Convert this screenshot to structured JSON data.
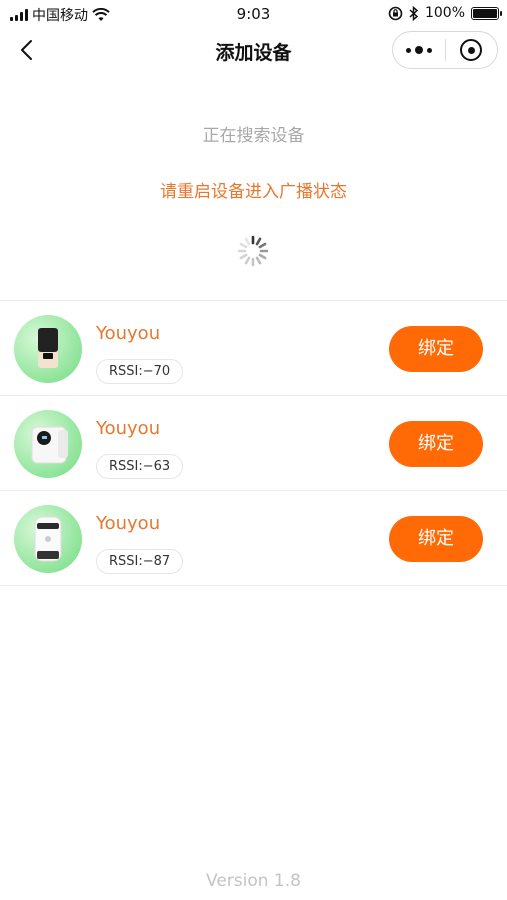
{
  "status_bar": {
    "carrier": "中国移动",
    "time": "9:03",
    "battery": "100%",
    "icons": [
      "signal-icon",
      "wifi-icon",
      "lock-rotation-icon",
      "bluetooth-icon",
      "battery-icon"
    ]
  },
  "nav": {
    "title": "添加设备",
    "back_icon": "chevron-left-icon",
    "more_icon": "more-dots-icon",
    "close_icon": "target-close-icon"
  },
  "search": {
    "status": "正在搜索设备",
    "hint": "请重启设备进入广播状态"
  },
  "devices": [
    {
      "name": "Youyou",
      "rssi": "RSSI:−70",
      "bind_label": "绑定",
      "icon": "device-thumbnail-1"
    },
    {
      "name": "Youyou",
      "rssi": "RSSI:−63",
      "bind_label": "绑定",
      "icon": "device-thumbnail-2"
    },
    {
      "name": "Youyou",
      "rssi": "RSSI:−87",
      "bind_label": "绑定",
      "icon": "device-thumbnail-3"
    }
  ],
  "footer": {
    "version": "Version 1.8"
  },
  "colors": {
    "accent": "#ff6a06",
    "accent_text": "#e8772e",
    "muted": "#a8a8a8",
    "avatar_green": "#8fe49a"
  }
}
